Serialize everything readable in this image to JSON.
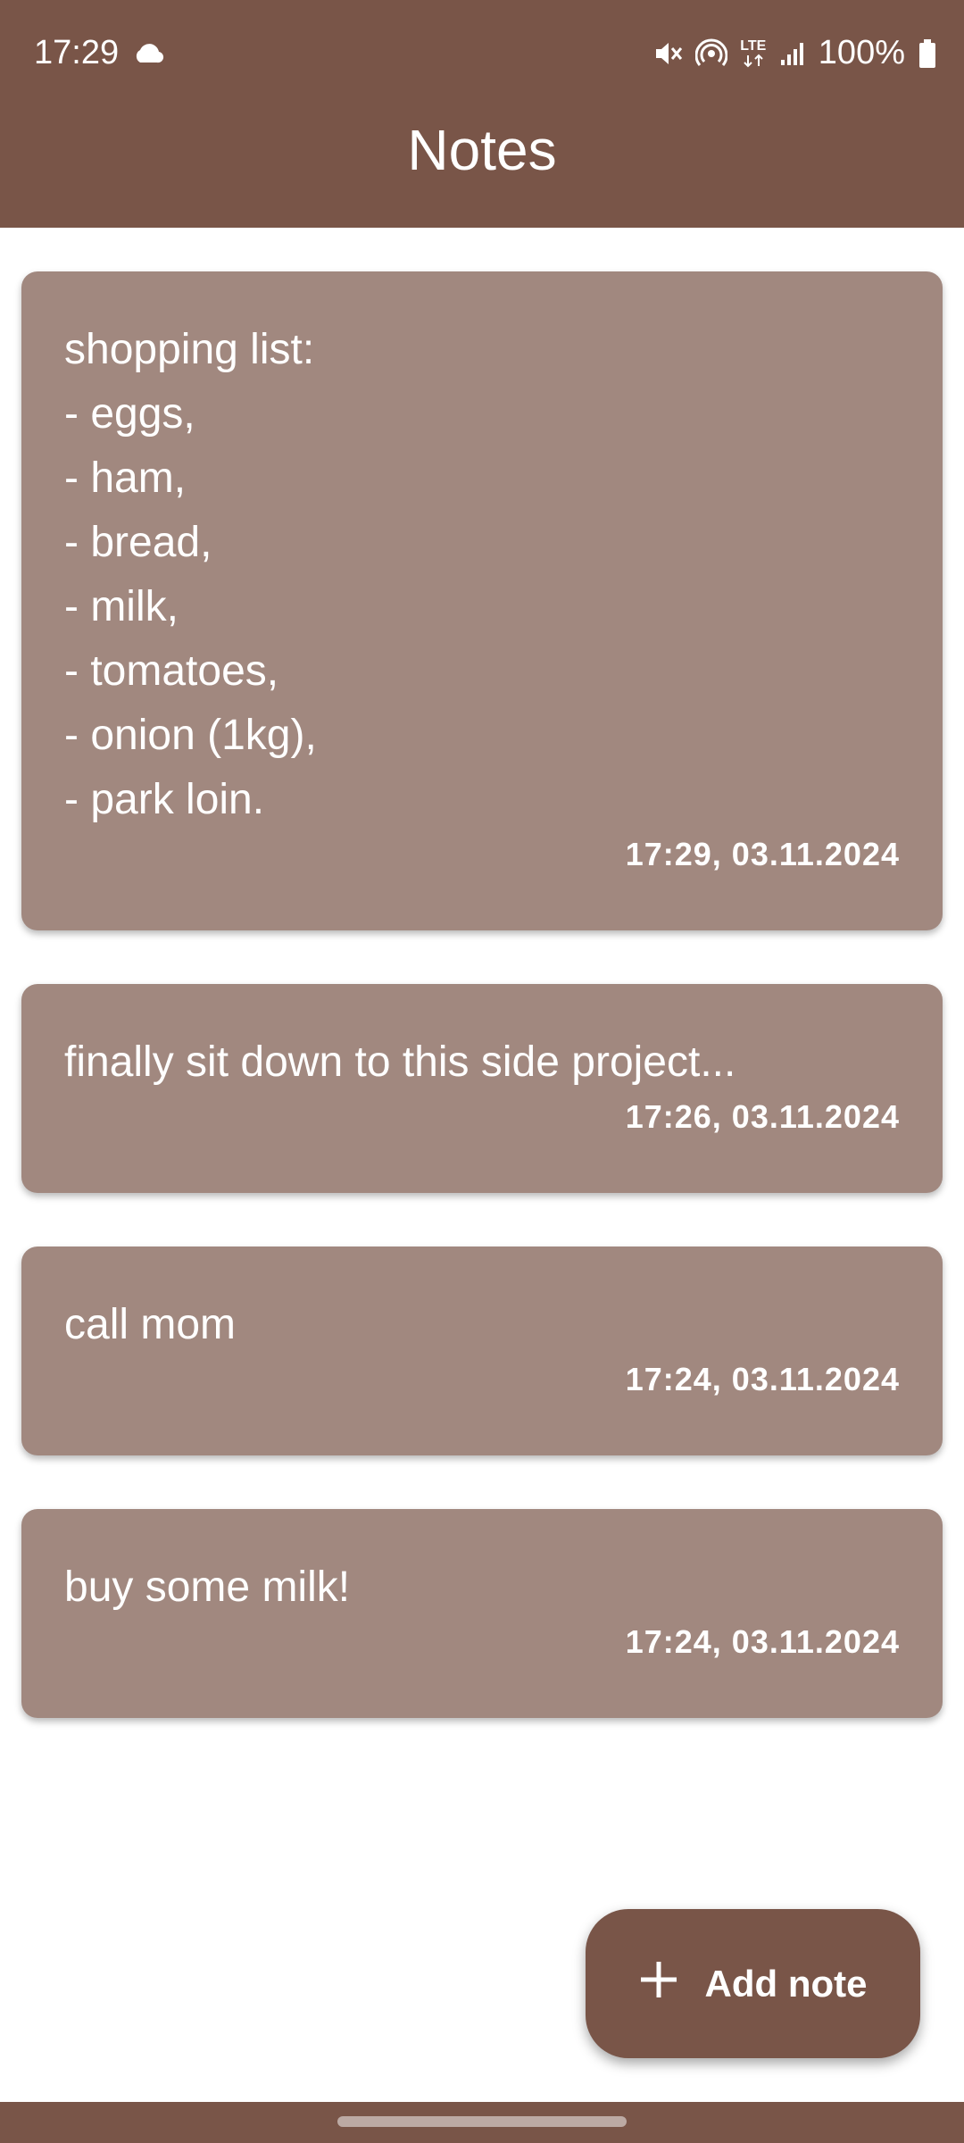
{
  "status_bar": {
    "time": "17:29",
    "network_label": "LTE",
    "battery_percent": "100%",
    "icons": [
      "cloud-icon",
      "mute-icon",
      "hotspot-icon",
      "lte-icon",
      "signal-icon",
      "battery-icon"
    ]
  },
  "app_bar": {
    "title": "Notes"
  },
  "notes": [
    {
      "text": "shopping list:\n- eggs,\n- ham,\n- bread,\n- milk,\n- tomatoes,\n- onion (1kg),\n- park loin.",
      "timestamp": "17:29, 03.11.2024"
    },
    {
      "text": "finally sit down to this side project...",
      "timestamp": "17:26, 03.11.2024"
    },
    {
      "text": "call mom",
      "timestamp": "17:24, 03.11.2024"
    },
    {
      "text": "buy some milk!",
      "timestamp": "17:24, 03.11.2024"
    }
  ],
  "fab": {
    "label": "Add note",
    "icon": "plus-icon"
  },
  "colors": {
    "primary": "#795548",
    "card": "#a1887f",
    "on_primary": "#ffffff",
    "nav_handle": "#bcaaa4"
  }
}
